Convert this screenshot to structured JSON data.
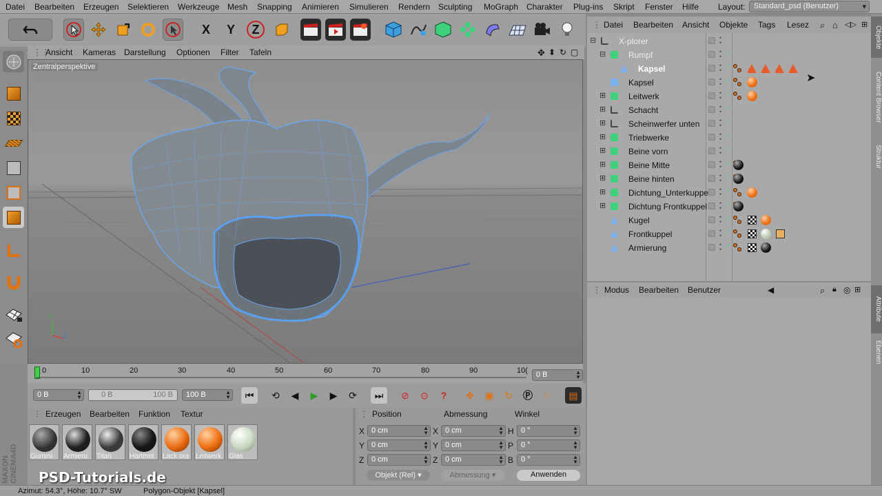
{
  "menubar": {
    "items": [
      "Datei",
      "Bearbeiten",
      "Erzeugen",
      "Selektieren",
      "Werkzeuge",
      "Mesh",
      "Snapping",
      "Animieren",
      "Simulieren",
      "Rendern",
      "Sculpting",
      "MoGraph",
      "Charakter",
      "Plug-ins",
      "Skript",
      "Fenster",
      "Hilfe"
    ],
    "layout_label": "Layout:",
    "layout_value": "Standard_psd (Benutzer)"
  },
  "toolbar": {
    "axis_x": "X",
    "axis_y": "Y",
    "axis_z": "Z"
  },
  "viewport": {
    "menu": [
      "Ansicht",
      "Kameras",
      "Darstellung",
      "Optionen",
      "Filter",
      "Tafeln"
    ],
    "label": "Zentralperspektive",
    "axis_y": "Y",
    "axis_z": "Z"
  },
  "timeline": {
    "ticks": [
      "0",
      "10",
      "20",
      "30",
      "40",
      "50",
      "60",
      "70",
      "80",
      "90",
      "10("
    ],
    "current": "0 B"
  },
  "playback": {
    "start": "0 B",
    "range_start": "0 B",
    "range_end": "100 B",
    "end": "100 B"
  },
  "materials": {
    "menu": [
      "Erzeugen",
      "Bearbeiten",
      "Funktion",
      "Textur"
    ],
    "items": [
      {
        "name": "Gummi",
        "color": "#303030"
      },
      {
        "name": "Armieru",
        "color": "#1e1e1e"
      },
      {
        "name": "Titan",
        "color": "#3a3a3a"
      },
      {
        "name": "Hartmet",
        "color": "#151515"
      },
      {
        "name": "Lack ora",
        "color": "#e86a10"
      },
      {
        "name": "Leitwerk",
        "color": "#ee6e10"
      },
      {
        "name": "Glas",
        "color": "#c9d8c0"
      }
    ]
  },
  "coords": {
    "headers": [
      "Position",
      "Abmessung",
      "Winkel"
    ],
    "pos": [
      "0 cm",
      "0 cm",
      "0 cm"
    ],
    "size": [
      "0 cm",
      "0 cm",
      "0 cm"
    ],
    "angle": [
      "0 °",
      "0 °",
      "0 °"
    ],
    "pos_labels": [
      "X",
      "Y",
      "Z"
    ],
    "size_labels": [
      "X",
      "Y",
      "Z"
    ],
    "angle_labels": [
      "H",
      "P",
      "B"
    ],
    "mode": "Objekt (Rel)",
    "size_mode": "Abmessung",
    "apply": "Anwenden"
  },
  "objects": {
    "menu": [
      "Datei",
      "Bearbeiten",
      "Ansicht",
      "Objekte",
      "Tags",
      "Lesez"
    ],
    "rows": [
      {
        "name": "X-plorer",
        "indent": 0,
        "icon": "null-icon",
        "exp": "⊟",
        "dim": true,
        "tags": ""
      },
      {
        "name": "Rumpf",
        "indent": 1,
        "icon": "symmetry-icon",
        "exp": "⊟",
        "dim": true,
        "tags": ""
      },
      {
        "name": "Kapsel",
        "indent": 2,
        "icon": "polygon-icon",
        "exp": "",
        "dim": false,
        "sel": true,
        "tags": "tri"
      },
      {
        "name": "Kapsel",
        "indent": 1,
        "icon": "capsule-icon",
        "exp": "",
        "dim": false,
        "tags": "orange"
      },
      {
        "name": "Leitwerk",
        "indent": 1,
        "icon": "sweep-icon",
        "exp": "⊞",
        "dim": false,
        "tags": "orange"
      },
      {
        "name": "Schacht",
        "indent": 1,
        "icon": "null-icon",
        "exp": "⊞",
        "dim": false,
        "tags": ""
      },
      {
        "name": "Scheinwerfer unten",
        "indent": 1,
        "icon": "null-icon",
        "exp": "⊞",
        "dim": false,
        "tags": ""
      },
      {
        "name": "Triebwerke",
        "indent": 1,
        "icon": "array-icon",
        "exp": "⊞",
        "dim": false,
        "tags": ""
      },
      {
        "name": "Beine vorn",
        "indent": 1,
        "icon": "array-icon",
        "exp": "⊞",
        "dim": false,
        "tags": ""
      },
      {
        "name": "Beine Mitte",
        "indent": 1,
        "icon": "array-icon",
        "exp": "⊞",
        "dim": false,
        "tags": "black"
      },
      {
        "name": "Beine hinten",
        "indent": 1,
        "icon": "array-icon",
        "exp": "⊞",
        "dim": false,
        "tags": "black"
      },
      {
        "name": "Dichtung_Unterkuppel",
        "indent": 1,
        "icon": "sweep-icon",
        "exp": "⊞",
        "dim": false,
        "tags": "orange"
      },
      {
        "name": "Dichtung Frontkuppel",
        "indent": 1,
        "icon": "sweep-icon",
        "exp": "⊞",
        "dim": false,
        "tags": "black"
      },
      {
        "name": "Kugel",
        "indent": 1,
        "icon": "polygon-icon",
        "exp": "",
        "dim": false,
        "tags": "chk-orange"
      },
      {
        "name": "Frontkuppel",
        "indent": 1,
        "icon": "polygon-icon",
        "exp": "",
        "dim": false,
        "tags": "chk-glass"
      },
      {
        "name": "Armierung",
        "indent": 1,
        "icon": "polygon-icon",
        "exp": "",
        "dim": false,
        "tags": "chk-black"
      }
    ]
  },
  "attributes": {
    "menu": [
      "Modus",
      "Bearbeiten",
      "Benutzer"
    ]
  },
  "sidetabs": [
    "Objekte",
    "Content Browser",
    "Struktur",
    "Attribute",
    "Ebenen"
  ],
  "status": {
    "left": "Azimut: 54.3°, Höhe: 10.7°  SW",
    "right": "Polygon-Objekt [Kapsel]"
  },
  "brand": {
    "logo": "PSD-Tutorials.de",
    "maxon": "MAXON CINEMA4D"
  }
}
